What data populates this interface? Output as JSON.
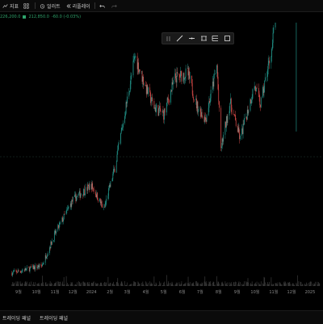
{
  "toolbar": {
    "indicators_label": "지표",
    "alert_label": "얼러트",
    "replay_label": "리플레이"
  },
  "price_line": {
    "ohlc_text": "226,200.0",
    "last_text": "212,850.0",
    "change_text": "-60.0 (-0.03%)"
  },
  "draw_toolbar": {
    "tools": [
      "drag-handle-icon",
      "trendline-icon",
      "horizontal-line-icon",
      "parallel-channel-icon",
      "fib-icon",
      "rectangle-icon"
    ]
  },
  "bottom_tabs": [
    "트레이딩 패널",
    "트레이딩 패널"
  ],
  "colors": {
    "up": "#26a69a",
    "down": "#ef5350",
    "background": "#000000",
    "volume": "#3a3a3a"
  },
  "chart_data": {
    "type": "candlestick",
    "x_tick_labels": [
      "9월",
      "10월",
      "11월",
      "12월",
      "2024",
      "2월",
      "3월",
      "4월",
      "5월",
      "6월",
      "7월",
      "8월",
      "9월",
      "10월",
      "11월",
      "12월",
      "2025"
    ],
    "ylim": [
      24000,
      76000
    ],
    "grid": false,
    "price_path": [
      {
        "x": "2023-08-20",
        "y": 26000
      },
      {
        "x": "2023-10-10",
        "y": 27500
      },
      {
        "x": "2023-11-01",
        "y": 34000
      },
      {
        "x": "2023-12-01",
        "y": 41000
      },
      {
        "x": "2024-01-01",
        "y": 44000
      },
      {
        "x": "2024-01-22",
        "y": 39000
      },
      {
        "x": "2024-02-10",
        "y": 48000
      },
      {
        "x": "2024-03-14",
        "y": 70500
      },
      {
        "x": "2024-04-01",
        "y": 64000
      },
      {
        "x": "2024-04-15",
        "y": 60000
      },
      {
        "x": "2024-05-01",
        "y": 58500
      },
      {
        "x": "2024-05-20",
        "y": 66000
      },
      {
        "x": "2024-06-10",
        "y": 67000
      },
      {
        "x": "2024-06-25",
        "y": 60500
      },
      {
        "x": "2024-07-10",
        "y": 57500
      },
      {
        "x": "2024-07-29",
        "y": 68500
      },
      {
        "x": "2024-08-05",
        "y": 51500
      },
      {
        "x": "2024-08-20",
        "y": 61000
      },
      {
        "x": "2024-09-06",
        "y": 53500
      },
      {
        "x": "2024-09-30",
        "y": 64500
      },
      {
        "x": "2024-10-10",
        "y": 60500
      },
      {
        "x": "2024-10-29",
        "y": 72000
      },
      {
        "x": "2024-11-22",
        "y": 99000
      },
      {
        "x": "2024-12-05",
        "y": 97000
      },
      {
        "x": "2024-12-18",
        "y": 105000
      },
      {
        "x": "2025-01-05",
        "y": 98000
      }
    ]
  }
}
